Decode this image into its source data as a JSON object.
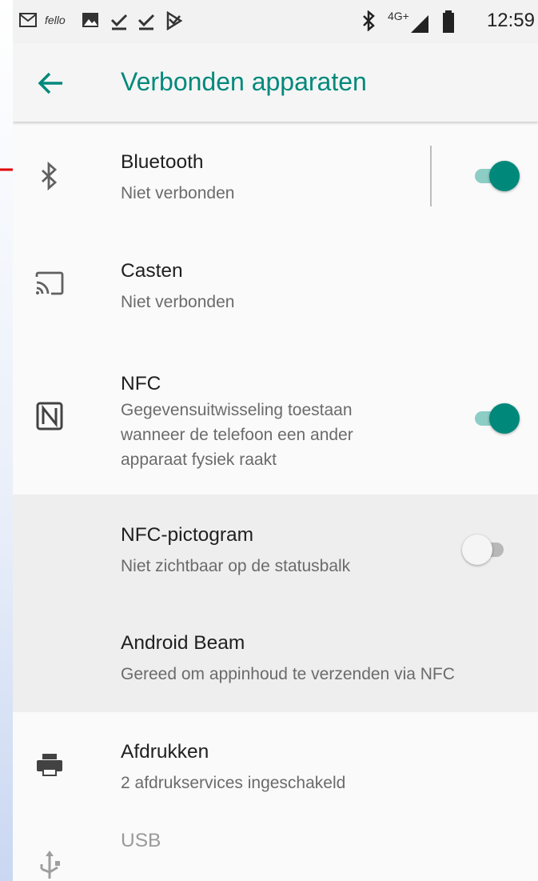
{
  "status_bar": {
    "app_label": "fello",
    "network": "4G+",
    "time": "12:59"
  },
  "header": {
    "title": "Verbonden apparaten"
  },
  "items": [
    {
      "title": "Bluetooth",
      "subtitle": "Niet verbonden",
      "icon": "bluetooth-icon",
      "toggle": "on"
    },
    {
      "title": "Casten",
      "subtitle": "Niet verbonden",
      "icon": "cast-icon"
    },
    {
      "title": "NFC",
      "subtitle": "Gegevensuitwisseling toestaan\nwanneer de telefoon een ander\napparaat fysiek raakt",
      "icon": "nfc-icon",
      "toggle": "on"
    },
    {
      "title": "NFC-pictogram",
      "subtitle": "Niet zichtbaar op de statusbalk",
      "toggle": "off"
    },
    {
      "title": "Android Beam",
      "subtitle": "Gereed om appinhoud te verzenden via NFC"
    },
    {
      "title": "Afdrukken",
      "subtitle": "2 afdrukservices ingeschakeld",
      "icon": "print-icon"
    },
    {
      "title": "USB",
      "subtitle": "",
      "icon": "usb-icon"
    }
  ],
  "colors": {
    "accent": "#00897b",
    "accent_track": "#8ccdc5",
    "annotation_arrow": "#e00000"
  }
}
